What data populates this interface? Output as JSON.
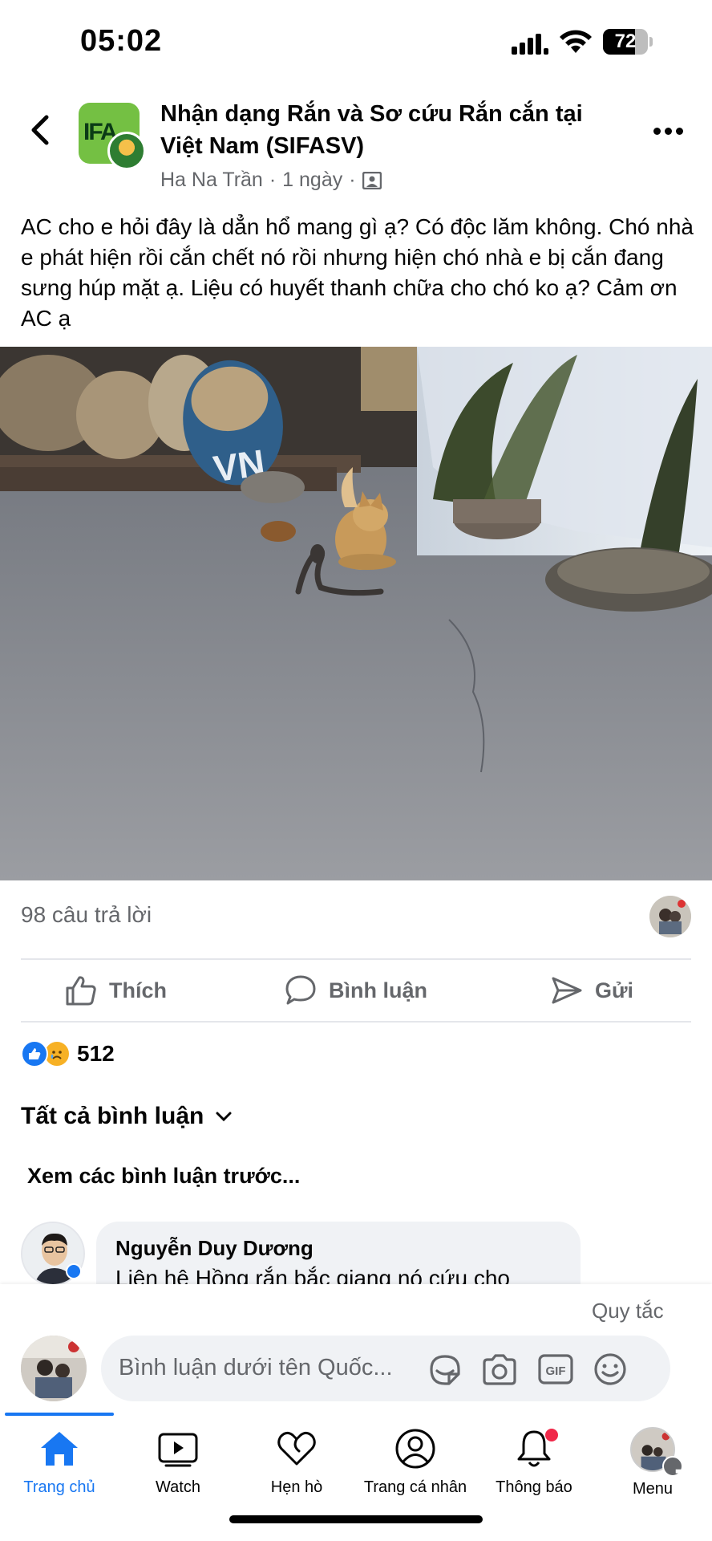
{
  "status_bar": {
    "time": "05:02",
    "battery_level": "72",
    "icons": [
      "signal-icon",
      "wifi-icon",
      "battery-icon"
    ]
  },
  "post": {
    "group_name": "Nhận dạng Rắn và Sơ cứu Rắn cắn tại Việt Nam (SIFASV)",
    "group_logo_text": "IFA",
    "author": "Ha Na Trần",
    "separator": "·",
    "time": "1 ngày",
    "text": "AC cho e hỏi đây là dẳn hổ mang gì ạ?  Có độc lăm không. Chó nhà e phát hiện rồi cắn chết nó rồi nhưng hiện chó nhà e bị cắn đang sưng húp mặt ạ. Liệu có huyết thanh chữa cho chó ko ạ?  Cảm ơn AC ạ",
    "photo_sign_text": "VN"
  },
  "stats": {
    "replies": "98 câu trả lời",
    "reaction_count": "512",
    "reaction_types": [
      "like",
      "sad"
    ]
  },
  "actions": {
    "like": "Thích",
    "comment": "Bình luận",
    "send": "Gửi"
  },
  "comments": {
    "filter": "Tất cả bình luận",
    "view_previous": "Xem các bình luận trước...",
    "items": [
      {
        "author": "Nguyễn Duy Dương",
        "text": "Liên hệ Hồng rắn bắc giang nó cứu cho"
      }
    ]
  },
  "composer": {
    "rules": "Quy tắc",
    "placeholder": "Bình luận dưới tên Quốc...",
    "icons": [
      "sticker-icon",
      "camera-icon",
      "gif-icon",
      "emoji-icon"
    ],
    "gif_label": "GIF"
  },
  "tabbar": {
    "tabs": [
      {
        "label": "Trang chủ",
        "icon": "home-icon",
        "active": true
      },
      {
        "label": "Watch",
        "icon": "watch-icon",
        "active": false
      },
      {
        "label": "Hẹn hò",
        "icon": "heart-icon",
        "active": false
      },
      {
        "label": "Trang cá nhân",
        "icon": "profile-icon",
        "active": false
      },
      {
        "label": "Thông báo",
        "icon": "bell-icon",
        "active": false
      },
      {
        "label": "Menu",
        "icon": "menu-avatar",
        "active": false
      }
    ]
  },
  "colors": {
    "accent": "#1877f2",
    "secondary_text": "#65676b",
    "notification": "#f02849"
  }
}
